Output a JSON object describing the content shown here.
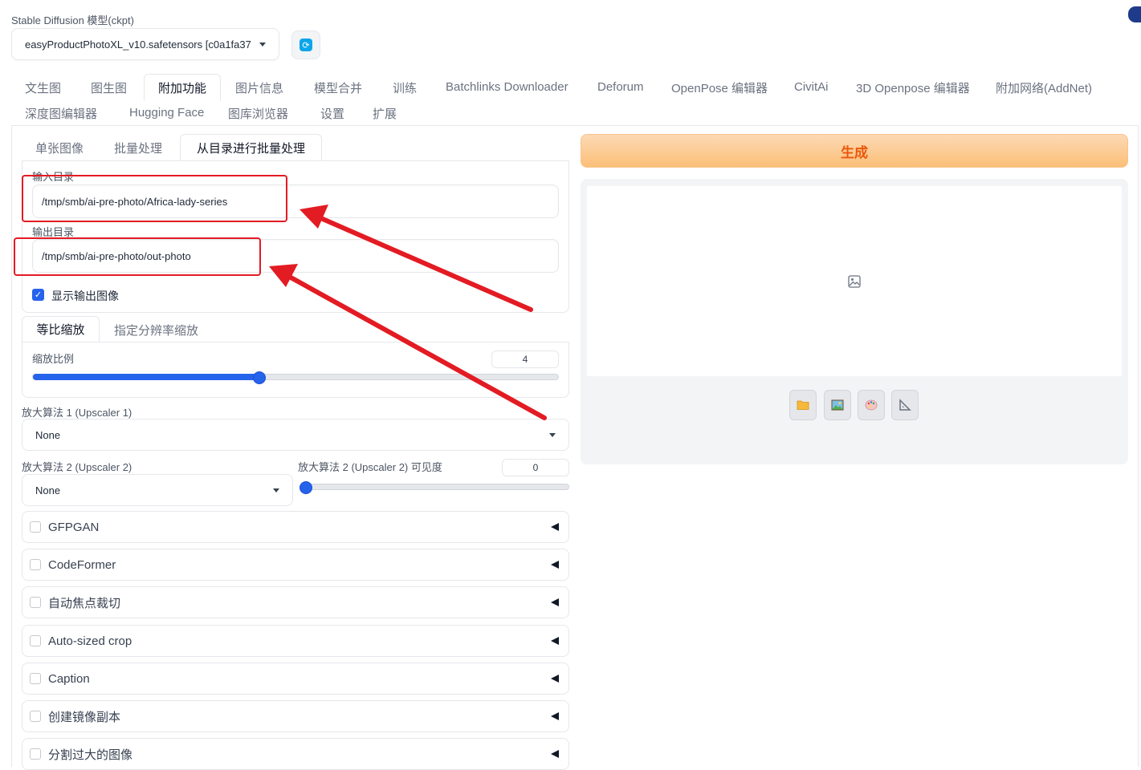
{
  "model": {
    "label": "Stable Diffusion 模型(ckpt)",
    "selected": "easyProductPhotoXL_v10.safetensors [c0a1fa37",
    "refresh_icon": "refresh-icon"
  },
  "main_tabs": [
    "文生图",
    "图生图",
    "附加功能",
    "图片信息",
    "模型合并",
    "训练",
    "Batchlinks Downloader",
    "Deforum",
    "OpenPose 编辑器",
    "CivitAi",
    "3D Openpose 编辑器",
    "附加网络(AddNet)",
    "深度图编辑器",
    "Hugging Face",
    "图库浏览器",
    "设置",
    "扩展"
  ],
  "active_main_tab": "附加功能",
  "sub_tabs": [
    "单张图像",
    "批量处理",
    "从目录进行批量处理"
  ],
  "active_sub_tab": "从目录进行批量处理",
  "batch": {
    "input_label": "输入目录",
    "input_value": "/tmp/smb/ai-pre-photo/Africa-lady-series",
    "output_label": "输出目录",
    "output_value": "/tmp/smb/ai-pre-photo/out-photo",
    "show_output_label": "显示输出图像",
    "show_output_checked": true
  },
  "scale_tabs": [
    "等比缩放",
    "指定分辨率缩放"
  ],
  "active_scale_tab": "等比缩放",
  "scale": {
    "label": "缩放比例",
    "value": "4",
    "slider_fraction": 0.43
  },
  "upscaler1": {
    "label": "放大算法 1 (Upscaler 1)",
    "value": "None"
  },
  "upscaler2": {
    "label": "放大算法 2 (Upscaler 2)",
    "value": "None"
  },
  "upscaler2_visibility": {
    "label": "放大算法 2 (Upscaler 2) 可见度",
    "value": "0",
    "slider_fraction": 0.0
  },
  "accordions": [
    "GFPGAN",
    "CodeFormer",
    "自动焦点裁切",
    "Auto-sized crop",
    "Caption",
    "创建镜像副本",
    "分割过大的图像"
  ],
  "generate_label": "生成",
  "output_tools": [
    "folder-icon",
    "image-icon",
    "palette-icon",
    "ruler-icon"
  ],
  "colors": {
    "accent": "#2563eb",
    "generate_text": "#ea580c",
    "annotation_red": "#e31b23"
  }
}
